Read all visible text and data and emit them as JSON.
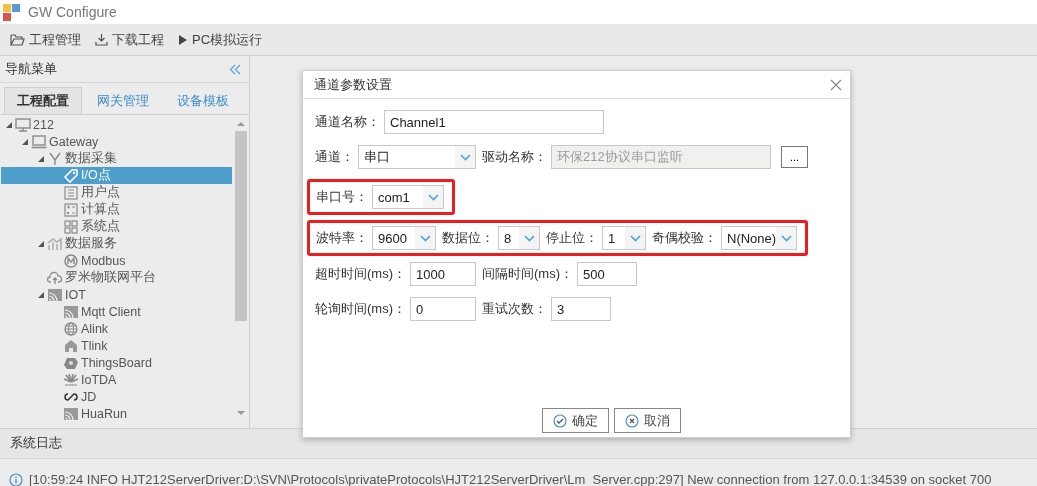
{
  "window": {
    "title": "GW Configure"
  },
  "toolbar": [
    {
      "label": "工程管理",
      "kind": "folder"
    },
    {
      "label": "下载工程",
      "kind": "download"
    },
    {
      "label": "PC模拟运行",
      "kind": "play"
    }
  ],
  "sidebar": {
    "title": "导航菜单",
    "tabs": [
      {
        "label": "工程配置",
        "selected": true
      },
      {
        "label": "网关管理",
        "selected": false
      },
      {
        "label": "设备模板",
        "selected": false
      }
    ],
    "tree": [
      {
        "label": "212",
        "kind": "monitor",
        "selected": false,
        "expanded": true,
        "children": [
          {
            "label": "Gateway",
            "kind": "laptop",
            "selected": false,
            "expanded": true,
            "children": [
              {
                "label": "数据采集",
                "kind": "fork",
                "selected": false,
                "expanded": true,
                "children": [
                  {
                    "label": "I/O点",
                    "kind": "tag",
                    "selected": true
                  },
                  {
                    "label": "用户点",
                    "kind": "list",
                    "selected": false
                  },
                  {
                    "label": "计算点",
                    "kind": "calc",
                    "selected": false
                  },
                  {
                    "label": "系统点",
                    "kind": "grid",
                    "selected": false
                  }
                ]
              },
              {
                "label": "数据服务",
                "kind": "bars",
                "selected": false,
                "expanded": true,
                "children": [
                  {
                    "label": "Modbus",
                    "kind": "circle-m",
                    "selected": false
                  }
                ]
              },
              {
                "label": "罗米物联网平台",
                "kind": "cloud",
                "selected": false
              },
              {
                "label": "IOT",
                "kind": "cast",
                "selected": false,
                "expanded": true,
                "children": [
                  {
                    "label": "Mqtt Client",
                    "kind": "cast",
                    "selected": false
                  },
                  {
                    "label": "Alink",
                    "kind": "globe",
                    "selected": false
                  },
                  {
                    "label": "Tlink",
                    "kind": "house",
                    "selected": false
                  },
                  {
                    "label": "ThingsBoard",
                    "kind": "chip",
                    "selected": false
                  },
                  {
                    "label": "IoTDA",
                    "kind": "petals",
                    "selected": false
                  },
                  {
                    "label": "JD",
                    "kind": "infinity",
                    "selected": false
                  },
                  {
                    "label": "HuaRun",
                    "kind": "cast",
                    "selected": false
                  }
                ]
              }
            ]
          }
        ]
      }
    ]
  },
  "dialog": {
    "title": "通道参数设置",
    "rows": [
      {
        "highlighted": false,
        "fields": [
          {
            "kind": "text",
            "label": "通道名称：",
            "value": "Channel1"
          }
        ]
      },
      {
        "highlighted": false,
        "fields": [
          {
            "kind": "select",
            "label": "通道：",
            "value": "串口"
          },
          {
            "kind": "readonly",
            "label": "驱动名称：",
            "value": "环保212协议串口监听"
          },
          {
            "kind": "button",
            "value": "..."
          }
        ]
      },
      {
        "highlighted": true,
        "fields": [
          {
            "kind": "select",
            "label": "串口号：",
            "value": "com1"
          }
        ]
      },
      {
        "highlighted": true,
        "fields": [
          {
            "kind": "select",
            "label": "波特率：",
            "value": "9600"
          },
          {
            "kind": "select",
            "label": "数据位：",
            "value": "8"
          },
          {
            "kind": "select",
            "label": "停止位：",
            "value": "1"
          },
          {
            "kind": "select",
            "label": "奇偶校验：",
            "value": "N(None)"
          }
        ]
      },
      {
        "highlighted": false,
        "fields": [
          {
            "kind": "text",
            "label": "超时时间(ms)：",
            "value": "1000"
          },
          {
            "kind": "text",
            "label": "间隔时间(ms)：",
            "value": "500"
          }
        ]
      },
      {
        "highlighted": false,
        "fields": [
          {
            "kind": "text",
            "label": "轮询时间(ms)：",
            "value": "0"
          },
          {
            "kind": "text",
            "label": "重试次数：",
            "value": "3"
          }
        ]
      }
    ],
    "buttons": [
      {
        "label": "确定",
        "kind": "ok"
      },
      {
        "label": "取消",
        "kind": "cancel"
      }
    ]
  },
  "log": {
    "title": "系统日志",
    "entries": [
      {
        "kind": "info",
        "text": "[10:59:24 INFO HJT212ServerDriver:D:\\SVN\\Protocols\\privateProtocols\\HJT212ServerDriver\\Lm_Server.cpp:297] New connection from 127.0.0.1:34539 on socket 700"
      }
    ]
  }
}
